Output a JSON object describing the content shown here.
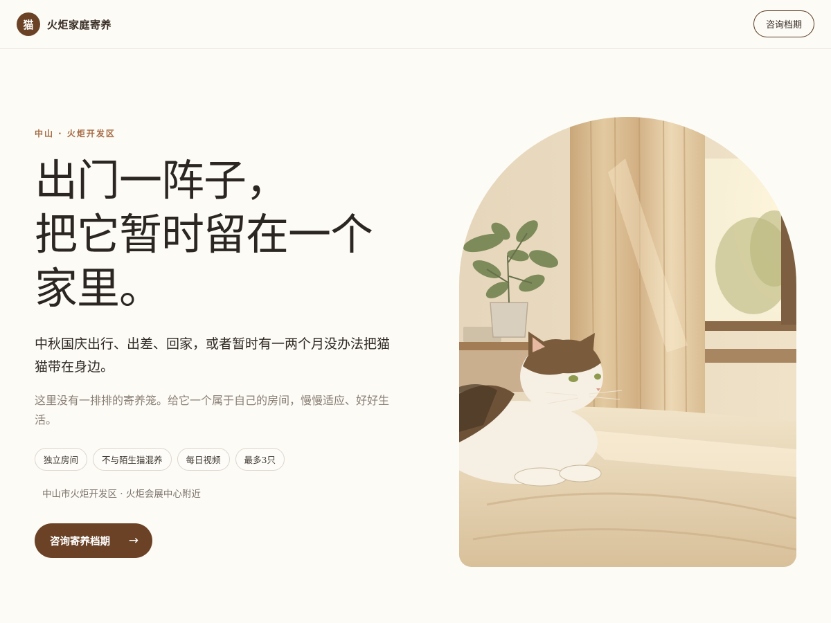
{
  "header": {
    "logo_char": "猫",
    "brand": "火炬家庭寄养",
    "button": "咨询档期"
  },
  "hero": {
    "location": "中山 · 火炬开发区",
    "headline": [
      "出门一阵子，",
      "把它暂时留在一个",
      "家里。"
    ],
    "lead": "中秋国庆出行、出差、回家，或者暂时有一两个月没办法把猫猫带在身边。",
    "sub": "这里没有一排排的寄养笼。给它一个属于自己的房间，慢慢适应、好好生活。",
    "tags": [
      "独立房间",
      "不与陌生猫混养",
      "每日视频",
      "最多3只"
    ],
    "address": "中山市火炬开发区 · 火炬会展中心附近",
    "cta": "咨询寄养档期",
    "cta_icon": "arrow-right-icon"
  },
  "colors": {
    "accent": "#6b4226",
    "location": "#a66a43",
    "background": "#fcfbf6"
  }
}
